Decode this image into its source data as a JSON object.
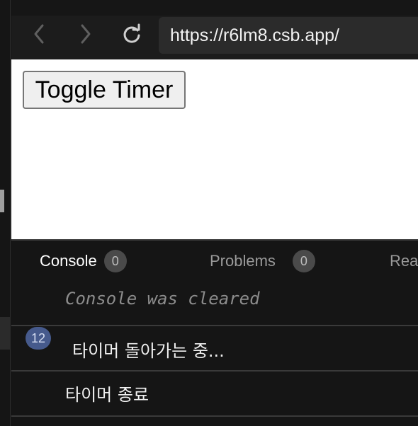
{
  "browser": {
    "url": "https://r6lm8.csb.app/",
    "back_icon": "chevron-left-icon",
    "forward_icon": "chevron-right-icon",
    "reload_icon": "reload-icon"
  },
  "preview": {
    "toggle_button_label": "Toggle Timer"
  },
  "devtools": {
    "tabs": [
      {
        "label": "Console",
        "count": "0"
      },
      {
        "label": "Problems",
        "count": "0"
      },
      {
        "label": "Rea"
      }
    ],
    "console": {
      "cleared_message": "Console was cleared",
      "entries": [
        {
          "repeat_count": "12",
          "text": "타이머 돌아가는 중..."
        },
        {
          "text": "타이머 종료"
        }
      ]
    }
  },
  "colors": {
    "background": "#151515",
    "toolbar": "#1c1c1c",
    "url_bar": "#2b2b2b",
    "preview": "#ffffff",
    "badge": "#4a4a4a",
    "repeat_badge": "#465a8c"
  }
}
